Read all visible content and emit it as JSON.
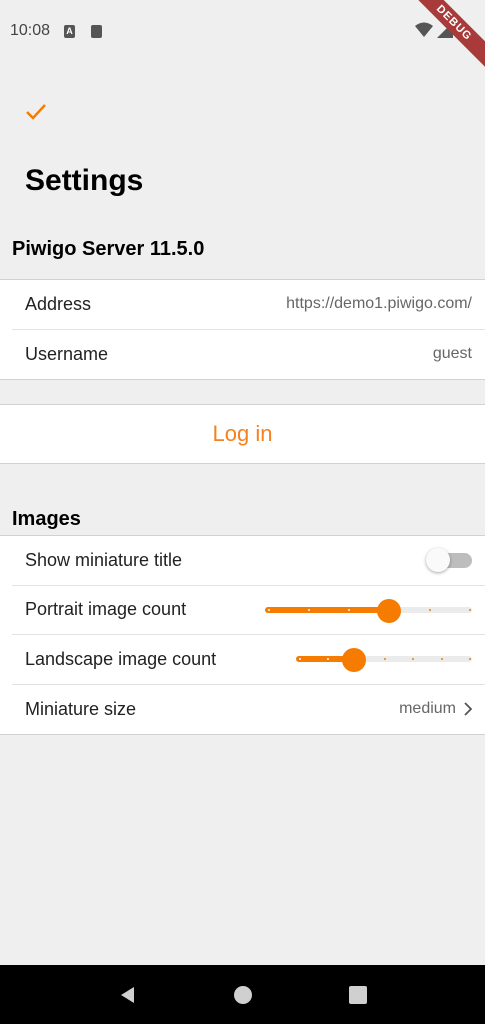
{
  "status_bar": {
    "time": "10:08",
    "debug_label": "DEBUG"
  },
  "header": {
    "title": "Settings"
  },
  "server_section": {
    "title": "Piwigo Server 11.5.0",
    "address_label": "Address",
    "address_value": "https://demo1.piwigo.com/",
    "username_label": "Username",
    "username_value": "guest",
    "login_label": "Log in"
  },
  "images_section": {
    "title": "Images",
    "show_title_label": "Show miniature title",
    "show_title_on": false,
    "portrait_label": "Portrait image count",
    "portrait_fraction": 0.6,
    "landscape_label": "Landscape image count",
    "landscape_fraction": 0.33,
    "miniature_size_label": "Miniature size",
    "miniature_size_value": "medium"
  },
  "colors": {
    "accent": "#f57c00",
    "background": "#efefef"
  }
}
